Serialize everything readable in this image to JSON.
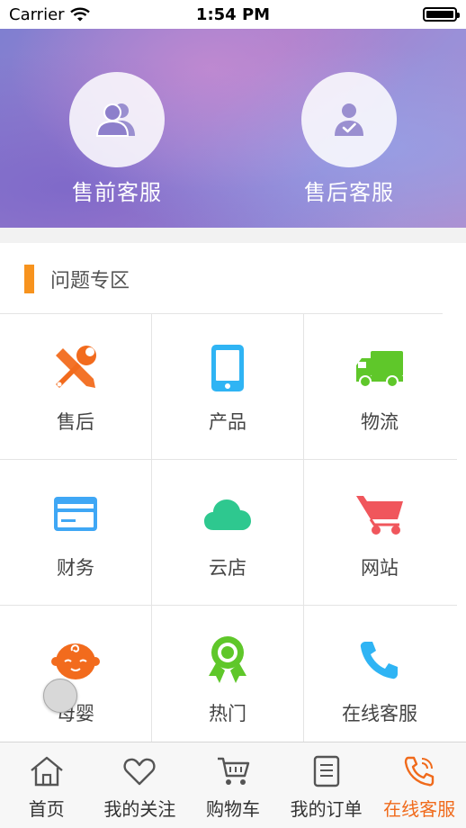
{
  "status_bar": {
    "carrier": "Carrier",
    "time": "1:54 PM"
  },
  "banner": {
    "pre_sale_label": "售前客服",
    "after_sale_label": "售后客服"
  },
  "section": {
    "title": "问题专区"
  },
  "grid": {
    "items": [
      {
        "label": "售后",
        "icon": "wrench-screwdriver-icon",
        "color": "#f26b1d"
      },
      {
        "label": "产品",
        "icon": "phone-icon",
        "color": "#2fb4f4"
      },
      {
        "label": "物流",
        "icon": "truck-icon",
        "color": "#5fc72a"
      },
      {
        "label": "财务",
        "icon": "card-icon",
        "color": "#3fa7f5"
      },
      {
        "label": "云店",
        "icon": "cloud-icon",
        "color": "#2ec88f"
      },
      {
        "label": "网站",
        "icon": "cart-icon",
        "color": "#f0565c"
      },
      {
        "label": "母婴",
        "icon": "baby-icon",
        "color": "#f26b1d"
      },
      {
        "label": "热门",
        "icon": "award-icon",
        "color": "#5fc72a"
      },
      {
        "label": "在线客服",
        "icon": "phone-call-icon",
        "color": "#2fb4f4"
      }
    ]
  },
  "tab_bar": {
    "active_color": "#f06a1b",
    "tabs": [
      {
        "label": "首页",
        "icon": "home-icon"
      },
      {
        "label": "我的关注",
        "icon": "heart-icon"
      },
      {
        "label": "购物车",
        "icon": "cart-icon"
      },
      {
        "label": "我的订单",
        "icon": "order-list-icon"
      },
      {
        "label": "在线客服",
        "icon": "phone-icon",
        "active": true
      }
    ]
  }
}
